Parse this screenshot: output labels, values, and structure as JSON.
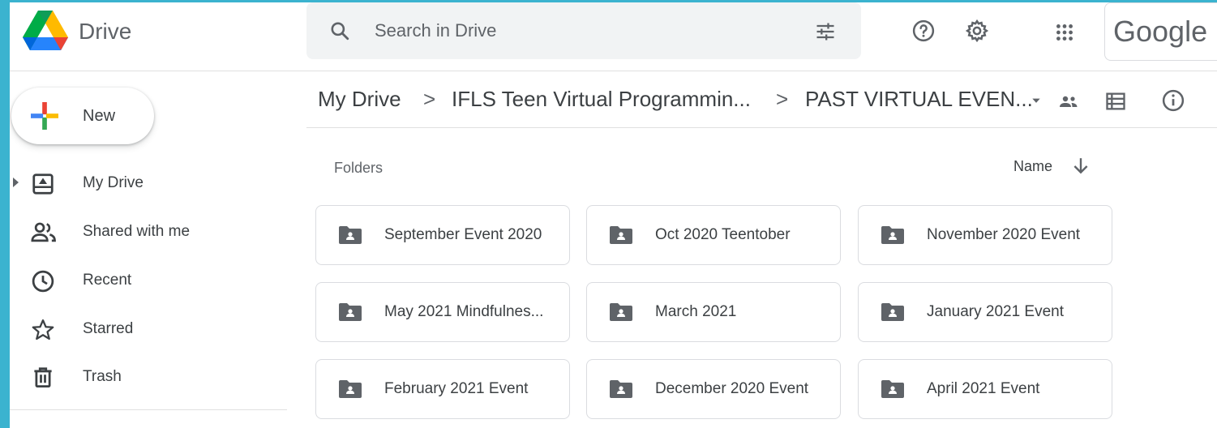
{
  "header": {
    "app_name": "Drive",
    "search_placeholder": "Search in Drive",
    "google_text": "Google",
    "icons": [
      "help-icon",
      "settings-icon",
      "apps-grid-icon",
      "search-options-icon"
    ]
  },
  "sidebar": {
    "new_label": "New",
    "items": [
      {
        "label": "My Drive",
        "icon": "my-drive-icon"
      },
      {
        "label": "Shared with me",
        "icon": "shared-icon"
      },
      {
        "label": "Recent",
        "icon": "clock-icon"
      },
      {
        "label": "Starred",
        "icon": "star-icon"
      },
      {
        "label": "Trash",
        "icon": "trash-icon"
      }
    ]
  },
  "breadcrumb": {
    "items": [
      "My Drive",
      "IFLS Teen Virtual Programmin...",
      "PAST VIRTUAL EVEN..."
    ],
    "separator": ">"
  },
  "main": {
    "section_label": "Folders",
    "sort_label": "Name",
    "folders": [
      "September Event 2020",
      "Oct 2020 Teentober",
      "November 2020 Event",
      "May 2021 Mindfulnes...",
      "March 2021",
      "January 2021 Event",
      "February 2021 Event",
      "December 2020 Event",
      "April 2021 Event"
    ]
  },
  "colors": {
    "background_border": "#3bb3cf",
    "text": "#3c4043",
    "icon": "#5f6368",
    "search_bg": "#f1f3f4"
  }
}
